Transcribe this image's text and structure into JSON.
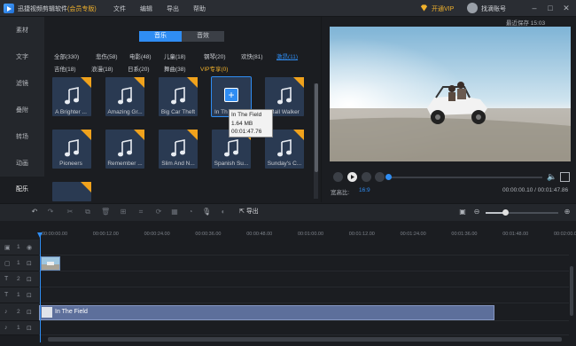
{
  "titlebar": {
    "app_name": "迅捷视频剪辑软件",
    "edition": "(会员专版)",
    "menu": [
      "文件",
      "编辑",
      "导出",
      "帮助"
    ],
    "open_vip": "开通VIP",
    "user_name": "找滴账号",
    "window_controls": [
      "minimize",
      "maximize",
      "close"
    ]
  },
  "sidebar": {
    "items": [
      {
        "label": "素材",
        "active": false
      },
      {
        "label": "文字",
        "active": false
      },
      {
        "label": "滤镜",
        "active": false
      },
      {
        "label": "叠附",
        "active": false
      },
      {
        "label": "转场",
        "active": false
      },
      {
        "label": "动画",
        "active": false
      },
      {
        "label": "配乐",
        "active": true
      }
    ]
  },
  "library": {
    "tabs": [
      {
        "label": "音乐",
        "active": true
      },
      {
        "label": "音效",
        "active": false
      }
    ],
    "categories_row1": [
      {
        "label": "全部(330)",
        "active": false
      },
      {
        "label": "悲伤(58)",
        "active": false
      },
      {
        "label": "电影(48)",
        "active": false
      },
      {
        "label": "儿童(18)",
        "active": false
      },
      {
        "label": "钢琴(20)",
        "active": false
      },
      {
        "label": "欢快(81)",
        "active": false
      },
      {
        "label": "激昂(11)",
        "active": true
      }
    ],
    "categories_row2": [
      {
        "label": "吉他(18)",
        "vip": false
      },
      {
        "label": "浪漫(18)",
        "vip": false
      },
      {
        "label": "日系(20)",
        "vip": false
      },
      {
        "label": "舞曲(38)",
        "vip": false
      },
      {
        "label": "VIP专享(0)",
        "vip": true
      }
    ],
    "tracks": [
      {
        "label": "A Brighter ...",
        "vip": true
      },
      {
        "label": "Amazing Gr...",
        "vip": true
      },
      {
        "label": "Big Car Theft",
        "vip": true
      },
      {
        "label": "In Th",
        "vip": false,
        "selected": true
      },
      {
        "label": "Mall Walker",
        "vip": true
      },
      {
        "label": "Pioneers",
        "vip": true
      },
      {
        "label": "Remember ...",
        "vip": true
      },
      {
        "label": "Slim And N...",
        "vip": true
      },
      {
        "label": "Spanish Su...",
        "vip": true
      },
      {
        "label": "Sunday's C...",
        "vip": true
      },
      {
        "label": "",
        "vip": true
      }
    ],
    "tooltip": {
      "name": "In The Field",
      "size": "1.64 MB",
      "duration": "00:01:47.76"
    }
  },
  "preview": {
    "autosave": "最近保存 15:03",
    "aspect_label": "宽高比:",
    "aspect_value": "16:9",
    "time_current": "00:00:00.10",
    "time_total": "00:01:47.86",
    "time_separator": "/",
    "progress": 0.01
  },
  "toolbar": {
    "export_label": "导出",
    "zoom_level": 0.27
  },
  "timeline": {
    "ruler": [
      "00:00:00.00",
      "00:00:12.00",
      "00:00:24.00",
      "00:00:36.00",
      "00:00:48.00",
      "00:01:00.00",
      "00:01:12.00",
      "00:01:24.00",
      "00:01:36.00",
      "00:01:48.00",
      "00:02:00.00"
    ],
    "tracks": [
      {
        "kind": "video",
        "num": "1"
      },
      {
        "kind": "video",
        "num": "1"
      },
      {
        "kind": "text",
        "num": "2"
      },
      {
        "kind": "text",
        "num": "1"
      },
      {
        "kind": "audio",
        "num": "2"
      },
      {
        "kind": "audio",
        "num": "1"
      }
    ],
    "audio_clip_label": "In The Field"
  },
  "colors": {
    "accent": "#2f8df3",
    "vip": "#f0b12c",
    "audio_clip": "#5d6f9b"
  }
}
